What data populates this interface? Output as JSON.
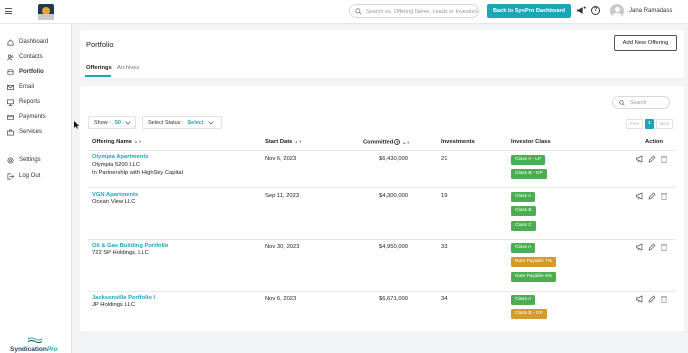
{
  "topbar": {
    "search_placeholder": "Search ex. Offering Name, Leads or Investors",
    "back_button": "Back to SynPro Dashboard",
    "user_name": "Jana Ramadass"
  },
  "sidebar": {
    "items": [
      {
        "label": "Dashboard",
        "icon": "home-icon"
      },
      {
        "label": "Contacts",
        "icon": "contacts-icon"
      },
      {
        "label": "Portfolio",
        "icon": "portfolio-icon",
        "active": true
      },
      {
        "label": "Email",
        "icon": "email-icon"
      },
      {
        "label": "Reports",
        "icon": "reports-icon"
      },
      {
        "label": "Payments",
        "icon": "payments-icon"
      },
      {
        "label": "Services",
        "icon": "services-icon"
      },
      {
        "label": "Settings",
        "icon": "settings-icon"
      },
      {
        "label": "Log Out",
        "icon": "logout-icon"
      }
    ],
    "brand": {
      "name": "Syndication",
      "suffix": "Pro"
    }
  },
  "header": {
    "title": "Portfolio",
    "add_button": "Add New Offering",
    "tabs": [
      {
        "label": "Offerings",
        "active": true
      },
      {
        "label": "Archives",
        "active": false
      }
    ]
  },
  "table": {
    "search_placeholder": "Search",
    "show_label": "Show :",
    "show_value": "50",
    "status_label": "Select Status :",
    "status_value": "Select",
    "pager": {
      "prev": "Prev",
      "page": "1",
      "next": "Next"
    },
    "columns": [
      "Offering Name",
      "Start Date",
      "Committed",
      "Investments",
      "Investor Class",
      "Action"
    ],
    "rows": [
      {
        "name": "Olympia Apartments",
        "sub": [
          "Olympia 5200 LLC",
          "In Partnership with HighSky Capital"
        ],
        "start_date": "Nov 6, 2023",
        "committed": "$6,430,000",
        "investments": "21",
        "classes": [
          {
            "label": "Class A - LP",
            "color": "#4cae52"
          },
          {
            "label": "Class B - GP",
            "color": "#4cae52"
          }
        ]
      },
      {
        "name": "VGN Apartments",
        "sub": [
          "Ocean View LLC"
        ],
        "start_date": "Sep 11, 2023",
        "committed": "$4,300,000",
        "investments": "19",
        "classes": [
          {
            "label": "Class A",
            "color": "#4cae52"
          },
          {
            "label": "Class B",
            "color": "#4cae52"
          },
          {
            "label": "Class C",
            "color": "#4cae52"
          }
        ]
      },
      {
        "name": "Oil & Gas Building Portfolio",
        "sub": [
          "722 SP Holdings, LLC"
        ],
        "start_date": "Nov 30, 2023",
        "committed": "$4,950,000",
        "investments": "33",
        "classes": [
          {
            "label": "Class A",
            "color": "#4cae52"
          },
          {
            "label": "Note Payable 7%",
            "color": "#d49a2d"
          },
          {
            "label": "Note Payable 8%",
            "color": "#4cae52"
          }
        ]
      },
      {
        "name": "Jacksonville Portfolio I",
        "sub": [
          "JP Holdings LLC"
        ],
        "start_date": "Nov 6, 2023",
        "committed": "$6,671,000",
        "investments": "34",
        "classes": [
          {
            "label": "Class A",
            "color": "#4cae52"
          },
          {
            "label": "Class B - GP",
            "color": "#d49a2d"
          }
        ]
      }
    ]
  },
  "colors": {
    "accent": "#1aa6b7",
    "green_badge": "#4cae52",
    "orange_badge": "#d49a2d",
    "brand_dark": "#1c3e5c"
  }
}
